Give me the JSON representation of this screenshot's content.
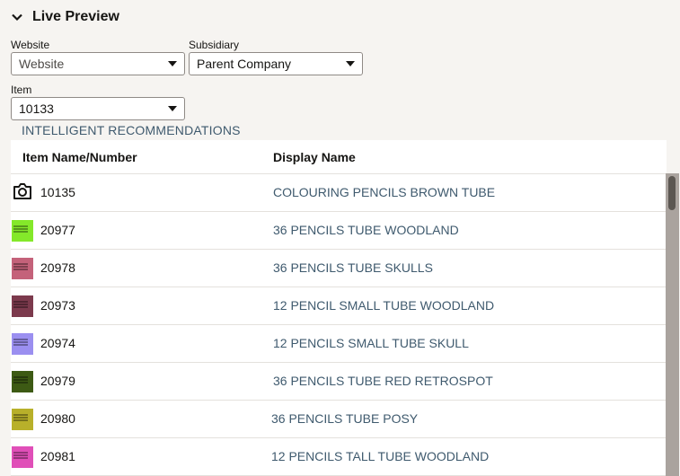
{
  "section": {
    "title": "Live Preview",
    "toggle_icon": "chevron-down-icon"
  },
  "filters": {
    "website": {
      "label": "Website",
      "value": "Website"
    },
    "subsidiary": {
      "label": "Subsidiary",
      "value": "Parent Company"
    },
    "item": {
      "label": "Item",
      "value": "10133"
    }
  },
  "recommendations": {
    "label": "INTELLIGENT RECOMMENDATIONS",
    "columns": {
      "item": "Item Name/Number",
      "display": "Display Name"
    },
    "rows": [
      {
        "number": "10135",
        "display": "COLOURING PENCILS BROWN TUBE",
        "thumb": "camera-icon"
      },
      {
        "number": "20977",
        "display": "36 PENCILS TUBE WOODLAND",
        "thumb_color": "#84e82a"
      },
      {
        "number": "20978",
        "display": "36 PENCILS TUBE SKULLS",
        "thumb_color": "#c4627a"
      },
      {
        "number": "20973",
        "display": "12 PENCIL SMALL TUBE WOODLAND",
        "thumb_color": "#7c3a4d"
      },
      {
        "number": "20974",
        "display": "12 PENCILS SMALL TUBE SKULL",
        "thumb_color": "#9b8ff0"
      },
      {
        "number": "20979",
        "display": "36 PENCILS TUBE RED RETROSPOT",
        "thumb_color": "#3d5a14"
      },
      {
        "number": "20980",
        "display": "36 PENCILS TUBE POSY",
        "thumb_color": "#b8b02a"
      },
      {
        "number": "20981",
        "display": "12 PENCILS TALL TUBE WOODLAND",
        "thumb_color": "#e04fb8"
      }
    ]
  },
  "colors": {
    "link": "#3f5a6e",
    "page_bg": "#f6f4f1",
    "scrollbar": "#aaa39e"
  }
}
